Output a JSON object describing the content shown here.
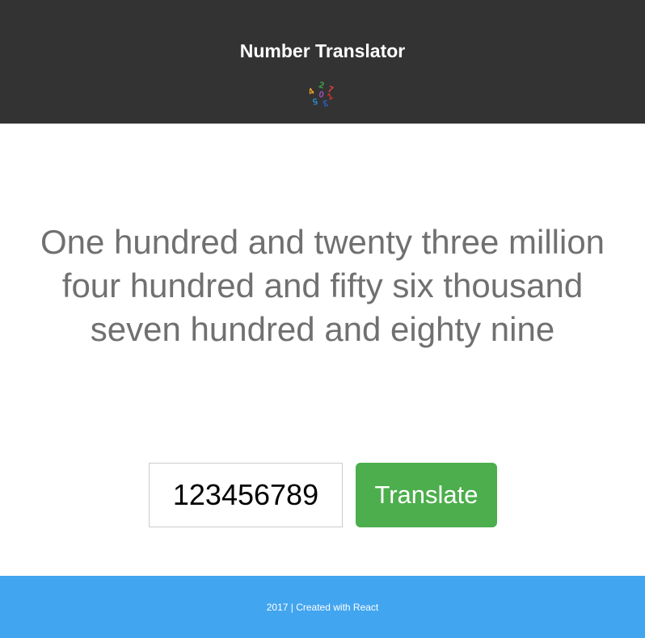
{
  "header": {
    "title": "Number Translator",
    "logo_icon": "colorful-numbers-logo-icon",
    "logo_digits": [
      "2",
      "7",
      "1",
      "4",
      "0",
      "5",
      "3"
    ],
    "background_color": "#333333"
  },
  "main": {
    "translation_text": "One hundred and twenty three million four hundred and fifty six thousand seven hundred and eighty nine",
    "input_value": "123456789",
    "translate_label": "Translate",
    "button_color": "#4cae4c"
  },
  "footer": {
    "text": "2017 | Created with React",
    "background_color": "#42a5f0"
  }
}
